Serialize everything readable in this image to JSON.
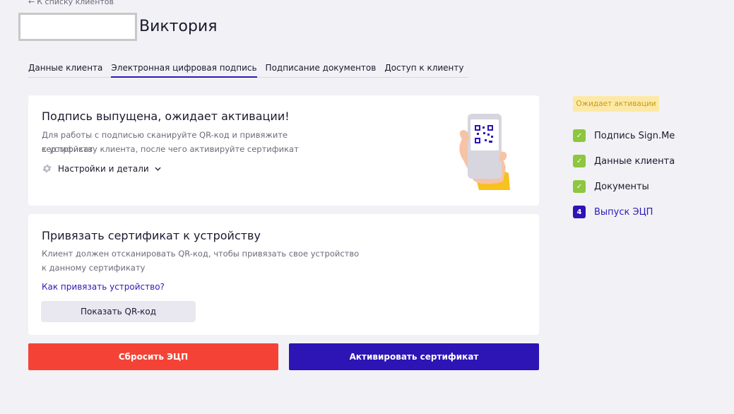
{
  "header": {
    "back_arrow": "←",
    "back_label": "К списку клиентов",
    "client_name": "Виктория"
  },
  "tabs": [
    {
      "label": "Данные клиента"
    },
    {
      "label": "Электронная цифровая подпись",
      "active": true
    },
    {
      "label": "Подписание документов"
    },
    {
      "label": "Доступ к клиенту"
    }
  ],
  "signature_card": {
    "title": "Подпись выпущена, ожидает активации!",
    "text_line1": "Для работы с подписью сканируйте QR-код и привяжите сертификат",
    "text_line2": "к устройству клиента, после чего активируйте сертификат",
    "settings_label": "Настройки и детали",
    "settings_icon": "gear-icon",
    "chevron_icon": "chevron-down-icon",
    "illustration": "hand-holding-phone-with-qr-code"
  },
  "bind_card": {
    "title": "Привязать сертификат к устройству",
    "text_line1": "Клиент должен отсканировать QR-код, чтобы привязать свое устройство",
    "text_line2": "к данному сертификату",
    "help_link": "Как привязать устройство?",
    "qr_button": "Показать QR-код"
  },
  "actions": {
    "reset_label": "Сбросить ЭЦП",
    "activate_label": "Активировать сертификат"
  },
  "sidebar": {
    "status_badge": "Ожидает активации",
    "steps": [
      {
        "label": "Подпись Sign.Me",
        "state": "done",
        "mark": "✓"
      },
      {
        "label": "Данные клиента",
        "state": "done",
        "mark": "✓"
      },
      {
        "label": "Документы",
        "state": "done",
        "mark": "✓"
      },
      {
        "label": "Выпуск ЭЦП",
        "state": "current",
        "mark": "4"
      }
    ]
  },
  "colors": {
    "accent": "#2c14b5",
    "danger": "#f44336",
    "success": "#8dc63f",
    "badge_bg": "#fde9a7",
    "badge_text": "#c99a14",
    "page_bg": "#f2f1f6"
  }
}
